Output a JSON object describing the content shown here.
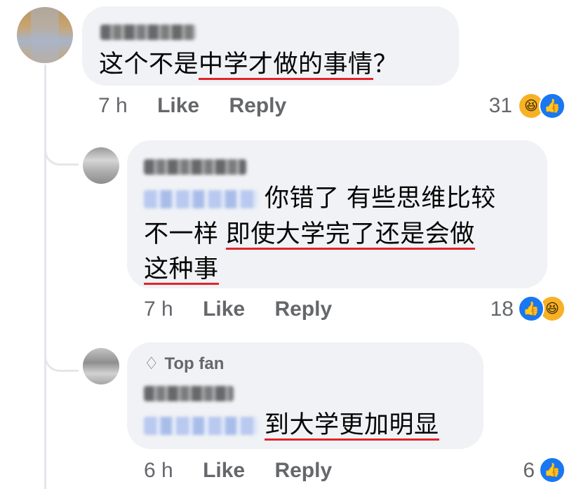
{
  "comments": [
    {
      "time": "7 h",
      "like_label": "Like",
      "reply_label": "Reply",
      "text_plain": "这个不是",
      "text_underlined": "中学才做的事情",
      "text_tail": "？",
      "reaction_count": "31",
      "reactions": [
        "haha-icon",
        "like-icon"
      ]
    },
    {
      "time": "7 h",
      "like_label": "Like",
      "reply_label": "Reply",
      "line1": "你错了 有些思维比较",
      "line2_plain": "不一样 ",
      "line2_underlined": "即使大学完了还是会做",
      "line3_underlined": "这种事",
      "reaction_count": "18",
      "reactions": [
        "like-icon",
        "haha-icon"
      ]
    },
    {
      "badge": "Top fan",
      "time": "6 h",
      "like_label": "Like",
      "reply_label": "Reply",
      "text_underlined": "到大学更加明显",
      "reaction_count": "6",
      "reactions": [
        "like-icon"
      ]
    }
  ],
  "colors": {
    "bubble": "#f0f2f5",
    "meta": "#65676b",
    "underline": "#e0242b",
    "like": "#1877f2",
    "haha": "#f7b125"
  }
}
